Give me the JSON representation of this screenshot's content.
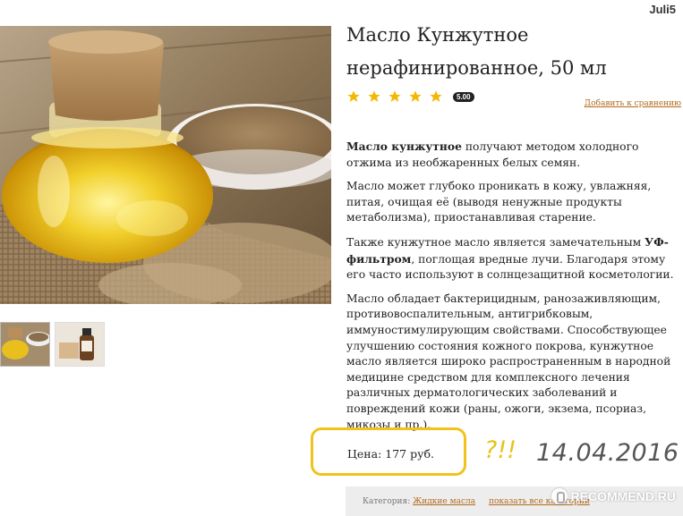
{
  "user_tag": "Juli5",
  "product": {
    "title": "Масло Кунжутное нерафинированное, 50 мл",
    "rating": 5,
    "rating_badge": "5.00",
    "compare_link": "Добавить к сравнению"
  },
  "description": {
    "p1_bold": "Масло кунжутное",
    "p1_rest": " получают методом холодного отжима из необжаренных белых семян.",
    "p2": "Масло может глубоко проникать в кожу, увлажняя, питая, очищая её (выводя ненужные продукты метаболизма), приостанавливая старение.",
    "p3_start": "Также кунжутное масло является замечательным ",
    "p3_bold": "УФ-фильтром",
    "p3_rest": ", поглощая вредные лучи. Благодаря этому его часто используют в солнцезащитной косметологии.",
    "p4": "Масло обладает бактерицидным, ранозаживляющим, противовоспалительным, антигрибковым, иммуностимулирующим свойствами. Способствующее улучшению состояния кожного покрова, кунжутное масло является широко распространенным в народной медицине средством для комплексного лечения различных дерматологических заболеваний и повреждений кожи (раны, ожоги, экзема, псориаз, микозы и пр.)."
  },
  "price": "Цена: 177 руб.",
  "annotations": {
    "question": "?!!",
    "date": "14.04.2016"
  },
  "category": {
    "label": "Категория:",
    "link": "Жидкие масла",
    "all_link": "показать все категории"
  },
  "watermark": "RECOMMEND.RU",
  "colors": {
    "star": "#f5b800",
    "link": "#b36b1e",
    "highlight": "#f0c31c",
    "oil": "#e3b514"
  }
}
